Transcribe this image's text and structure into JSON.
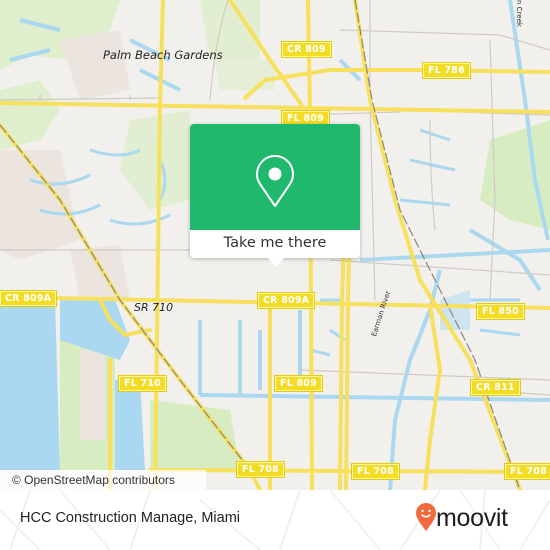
{
  "map": {
    "place_labels": {
      "city": "Palm Beach Gardens",
      "road_name": "SR 710",
      "river": "Earman River",
      "creek": "n Creek"
    },
    "road_shields": [
      {
        "id": "cr-809-top",
        "label": "CR 809"
      },
      {
        "id": "fl-786",
        "label": "FL 786"
      },
      {
        "id": "fl-809-top",
        "label": "FL 809"
      },
      {
        "id": "cr-809a-left",
        "label": "CR 809A"
      },
      {
        "id": "cr-809a-center",
        "label": "CR 809A"
      },
      {
        "id": "fl-850",
        "label": "FL 850"
      },
      {
        "id": "fl-710",
        "label": "FL 710"
      },
      {
        "id": "fl-809-bottom",
        "label": "FL 809"
      },
      {
        "id": "cr-811",
        "label": "CR 811"
      },
      {
        "id": "fl-708-left",
        "label": "FL 708"
      },
      {
        "id": "fl-708-center",
        "label": "FL 708"
      },
      {
        "id": "fl-708-right",
        "label": "FL 708"
      }
    ],
    "attribution": "© OpenStreetMap contributors",
    "colors": {
      "land": "#f2f0ec",
      "water": "#a9d8f0",
      "park": "#d5ebb8",
      "road_major": "#f6e05c",
      "road_minor": "#cfcac4"
    }
  },
  "popup": {
    "icon": "map-pin-icon",
    "cta_label": "Take me there",
    "accent_color": "#1fb86d"
  },
  "footer": {
    "place_name": "HCC Construction Manage, Miami",
    "brand": "moovit",
    "brand_icon": "moovit-smile-pin-icon",
    "brand_color": "#f26a3b"
  }
}
